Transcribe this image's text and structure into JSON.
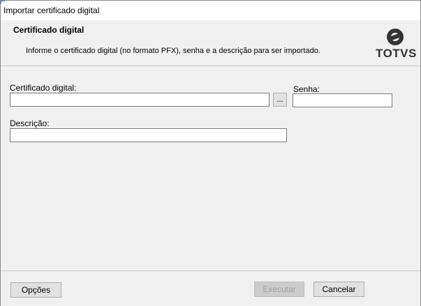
{
  "window": {
    "title": "Importar certificado digital"
  },
  "header": {
    "heading": "Certificado digital",
    "description": "Informe o certificado digital (no formato PFX), senha e a descrição para ser importado.",
    "logo_text": "TOTVS"
  },
  "form": {
    "certificate_label": "Certificado digital:",
    "certificate_value": "",
    "browse_label": "...",
    "password_label": "Senha:",
    "password_value": "",
    "description_label": "Descrição:",
    "description_value": ""
  },
  "footer": {
    "options_label": "Opções",
    "execute_label": "Executar",
    "cancel_label": "Cancelar"
  },
  "icons": {
    "logo": "totvs-logo-icon"
  }
}
